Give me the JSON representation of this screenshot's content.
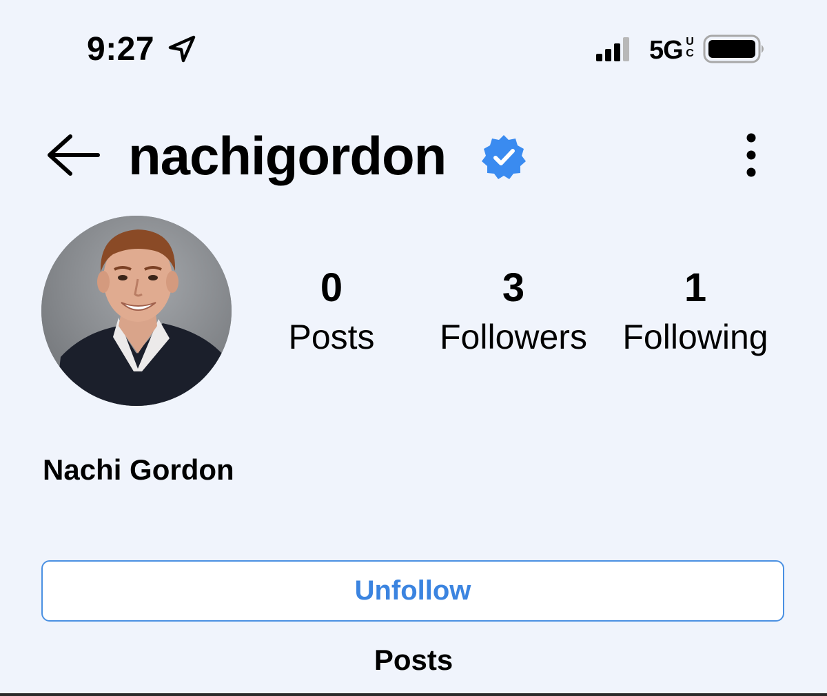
{
  "status_bar": {
    "time": "9:27",
    "network": "5G",
    "network_badge_top": "U",
    "network_badge_bottom": "C",
    "icons": [
      "location-arrow-icon",
      "cellular-signal-icon",
      "battery-icon"
    ]
  },
  "header": {
    "username": "nachigordon",
    "verified": true,
    "icons": [
      "back-arrow-icon",
      "verified-badge-icon",
      "more-options-icon"
    ]
  },
  "profile": {
    "display_name": "Nachi Gordon",
    "stats": [
      {
        "value": "0",
        "label": "Posts"
      },
      {
        "value": "3",
        "label": "Followers"
      },
      {
        "value": "1",
        "label": "Following"
      }
    ]
  },
  "actions": {
    "unfollow_label": "Unfollow"
  },
  "tabs": {
    "posts_label": "Posts"
  },
  "colors": {
    "background": "#f0f4fc",
    "accent": "#3b84e0",
    "verified": "#3a8bf0"
  }
}
